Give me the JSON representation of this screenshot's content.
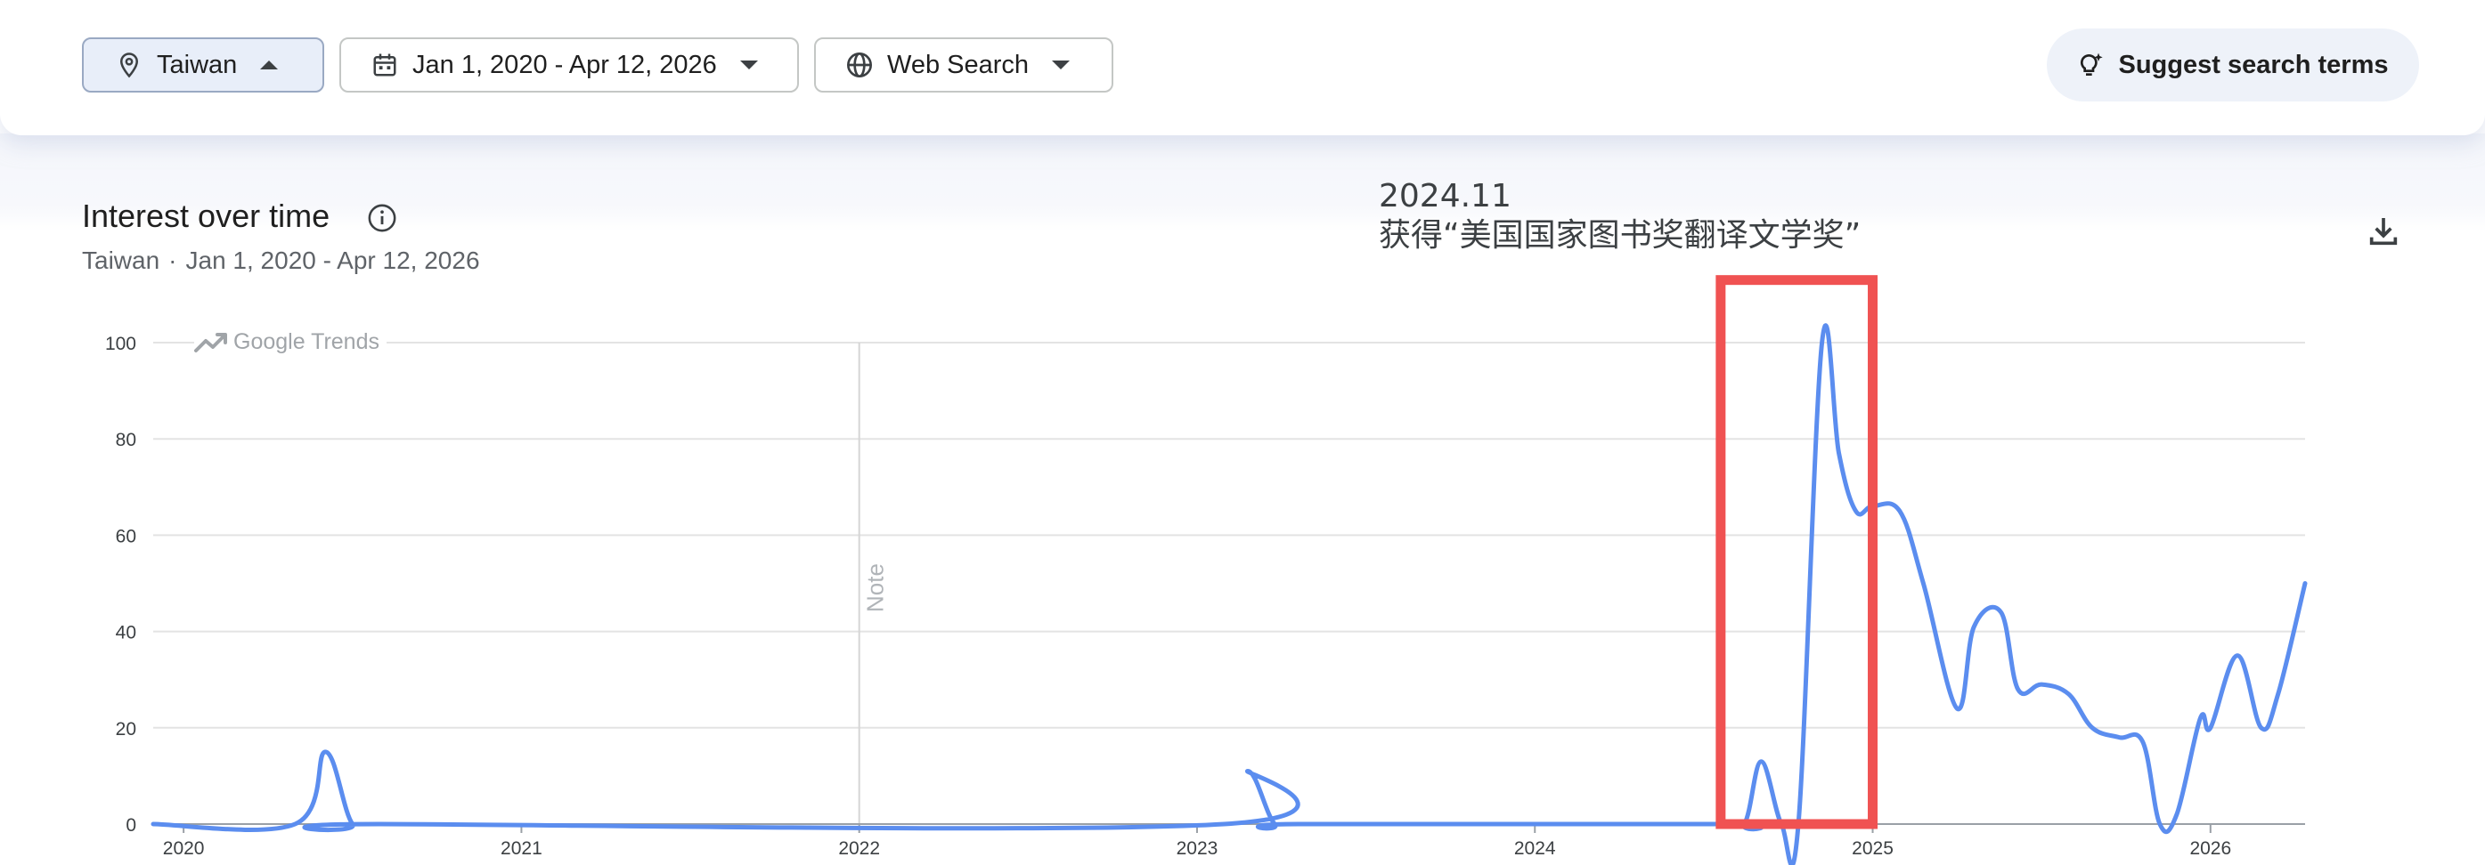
{
  "toolbar": {
    "region_label": "Taiwan",
    "date_range_label": "Jan 1, 2020 - Apr 12, 2026",
    "search_type_label": "Web Search",
    "suggest_label": "Suggest search terms"
  },
  "panel": {
    "title": "Interest over time",
    "subtitle_region": "Taiwan",
    "subtitle_separator": "·",
    "subtitle_range": "Jan 1, 2020 - Apr 12, 2026",
    "watermark": "Google Trends"
  },
  "annotation": {
    "line1": "2024.11",
    "line2": "获得“美国国家图书奖翻译文学奖”",
    "box_color": "#f05252",
    "box_x_start": 2024.55,
    "box_x_end": 2025.0,
    "box_y_start": 0,
    "box_y_end": 113
  },
  "chart_data": {
    "type": "line",
    "color": "#5b8def",
    "grid": true,
    "xlim": [
      2019.91,
      2026.28
    ],
    "ylim": [
      0,
      100
    ],
    "yticks": [
      "0",
      "20",
      "40",
      "60",
      "80",
      "100"
    ],
    "xticks": [
      "2020",
      "2021",
      "2022",
      "2023",
      "2024",
      "2025",
      "2026"
    ],
    "note_x": 2022.0,
    "note_label": "Note",
    "series": [
      {
        "x": [
          2019.91,
          2020.33,
          2020.42,
          2020.5,
          2020.58,
          2023.08,
          2023.15,
          2023.23,
          2023.3,
          2024.55,
          2024.62,
          2024.67,
          2024.73,
          2024.78,
          2024.85,
          2024.9,
          2024.95,
          2025.0,
          2025.08,
          2025.15,
          2025.25,
          2025.3,
          2025.38,
          2025.43,
          2025.5,
          2025.58,
          2025.65,
          2025.73,
          2025.8,
          2025.85,
          2025.9,
          2025.97,
          2026.0,
          2026.08,
          2026.15,
          2026.2,
          2026.28
        ],
        "y": [
          0,
          0,
          15,
          0,
          0,
          0,
          11,
          0,
          0,
          0,
          0,
          13,
          0,
          0,
          100,
          77,
          65,
          66,
          65,
          50,
          24,
          41,
          44,
          28,
          29,
          27,
          20,
          18,
          17,
          0,
          2,
          22,
          20,
          35,
          20,
          27,
          50
        ]
      }
    ]
  }
}
